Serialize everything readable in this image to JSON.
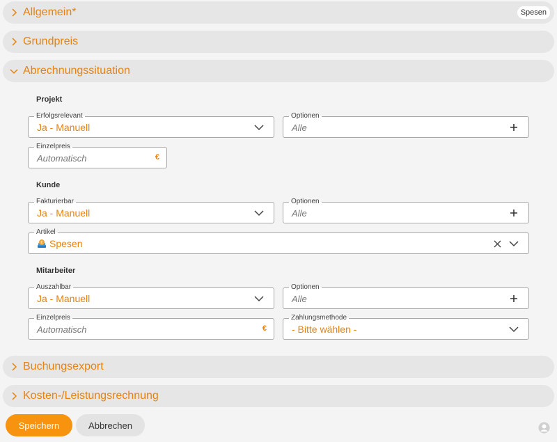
{
  "sections": {
    "allgemein": {
      "title": "Allgemein*",
      "badge": "Spesen"
    },
    "grundpreis": {
      "title": "Grundpreis"
    },
    "abrechnung": {
      "title": "Abrechnungssituation"
    },
    "buchungsexport": {
      "title": "Buchungsexport"
    },
    "kosten": {
      "title": "Kosten-/Leistungsrechnung"
    }
  },
  "projekt": {
    "heading": "Projekt",
    "erfolgsrelevant": {
      "label": "Erfolgsrelevant",
      "value": "Ja - Manuell"
    },
    "optionen": {
      "label": "Optionen",
      "placeholder": "Alle"
    },
    "einzelpreis": {
      "label": "Einzelpreis",
      "placeholder": "Automatisch",
      "currency": "€"
    }
  },
  "kunde": {
    "heading": "Kunde",
    "fakturierbar": {
      "label": "Fakturierbar",
      "value": "Ja - Manuell"
    },
    "optionen": {
      "label": "Optionen",
      "placeholder": "Alle"
    },
    "artikel": {
      "label": "Artikel",
      "value": "Spesen"
    }
  },
  "mitarbeiter": {
    "heading": "Mitarbeiter",
    "auszahlbar": {
      "label": "Auszahlbar",
      "value": "Ja - Manuell"
    },
    "optionen": {
      "label": "Optionen",
      "placeholder": "Alle"
    },
    "einzelpreis": {
      "label": "Einzelpreis",
      "placeholder": "Automatisch",
      "currency": "€"
    },
    "zahlungsmethode": {
      "label": "Zahlungsmethode",
      "value": "- Bitte wählen -"
    }
  },
  "buttons": {
    "save": "Speichern",
    "cancel": "Abbrechen"
  },
  "colors": {
    "accent": "#e8820c",
    "primary_button": "#f7930f"
  }
}
